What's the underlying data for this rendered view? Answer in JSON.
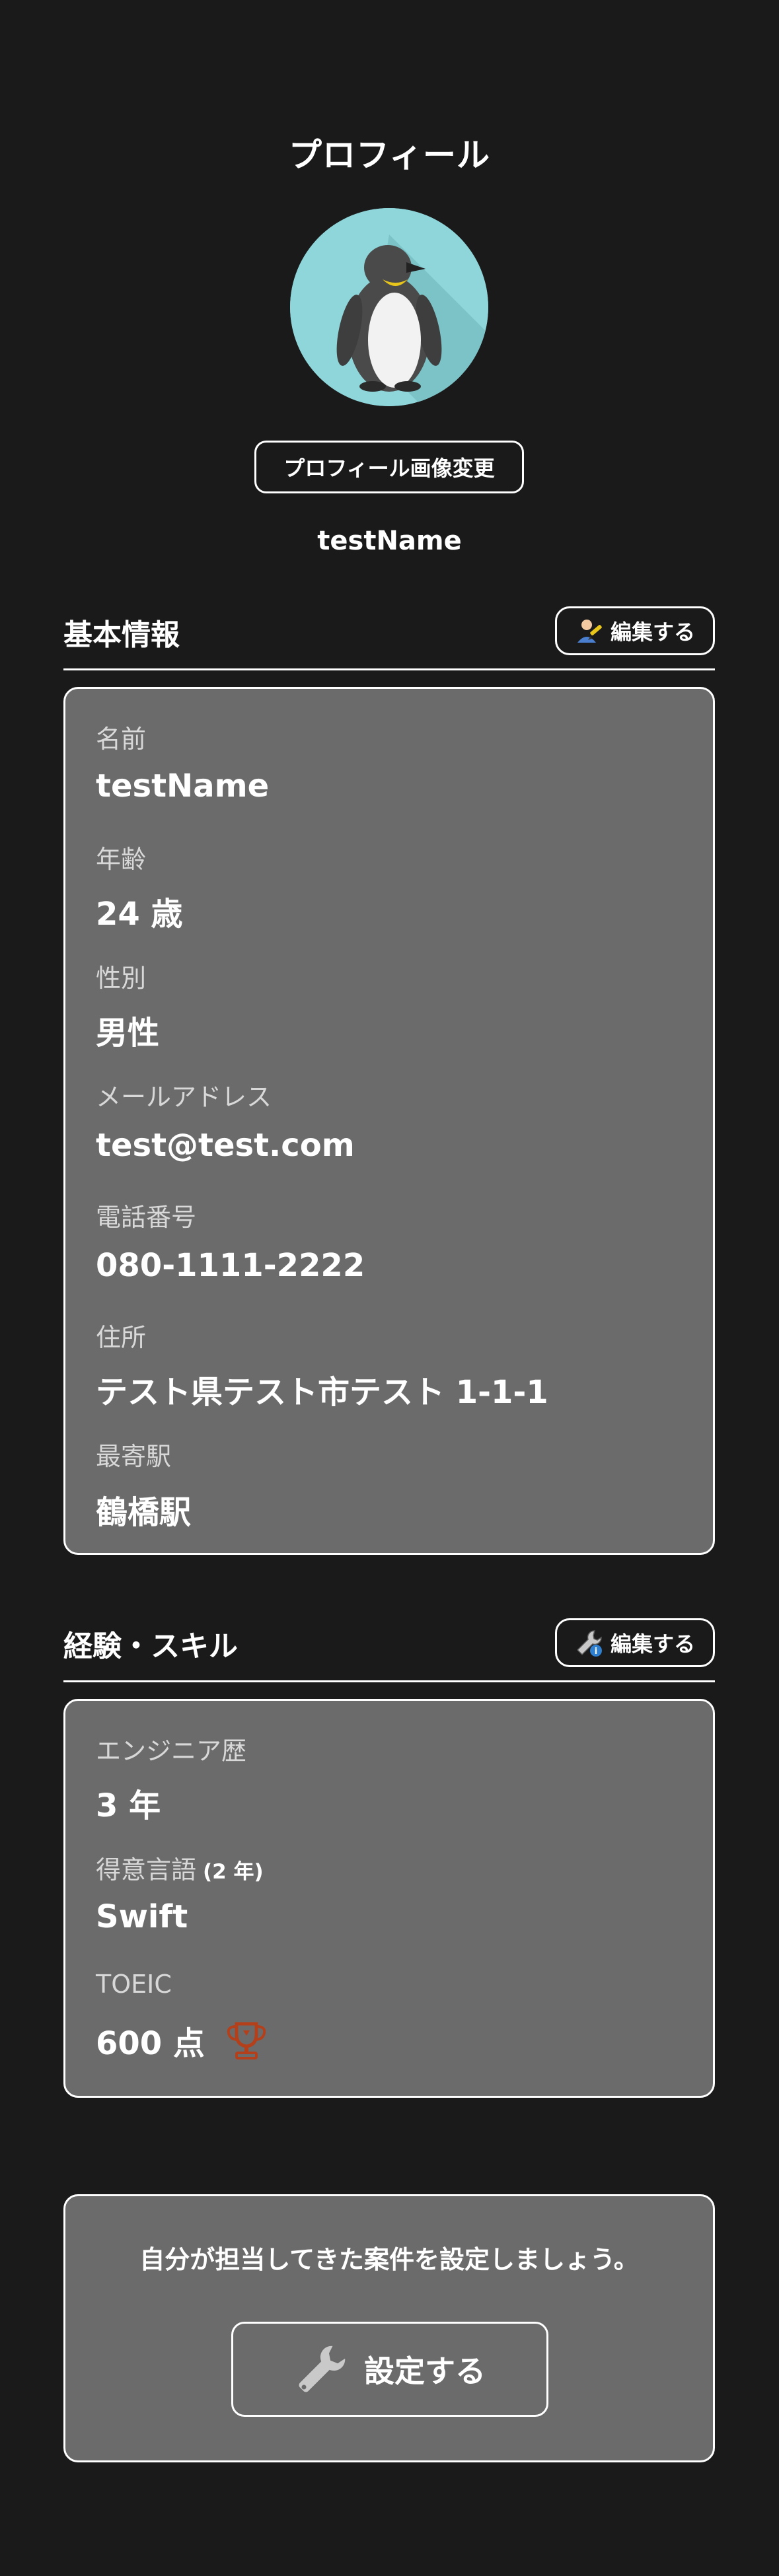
{
  "header": {
    "title": "プロフィール"
  },
  "profile": {
    "change_image_label": "プロフィール画像変更",
    "username": "testName",
    "avatar_icon": "penguin-icon"
  },
  "basic_info": {
    "title": "基本情報",
    "edit_label": "編集する",
    "edit_icon": "user-edit-icon",
    "fields": [
      {
        "label": "名前",
        "value": "testName"
      },
      {
        "label": "年齢",
        "value": "24 歳"
      },
      {
        "label": "性別",
        "value": "男性"
      },
      {
        "label": "メールアドレス",
        "value": "test@test.com"
      },
      {
        "label": "電話番号",
        "value": "080-1111-2222"
      },
      {
        "label": "住所",
        "value": "テスト県テスト市テスト 1-1-1"
      },
      {
        "label": "最寄駅",
        "value": "鶴橋駅"
      }
    ]
  },
  "skills": {
    "title": "経験・スキル",
    "edit_label": "編集する",
    "edit_icon": "wrench-edit-icon",
    "fields": [
      {
        "label": "エンジニア歴",
        "value": "3 年"
      },
      {
        "label": "得意言語",
        "sub": "(2 年)",
        "value": "Swift"
      },
      {
        "label": "TOEIC",
        "value": "600 点",
        "icon": "trophy-icon"
      }
    ]
  },
  "projects": {
    "prompt": "自分が担当してきた案件を設定しましょう。",
    "button_label": "設定する",
    "button_icon": "wrench-icon"
  },
  "colors": {
    "background": "#1a1a1a",
    "card": "#6b6b6b",
    "avatar_bg": "#8fd6db",
    "trophy": "#b3401b"
  }
}
